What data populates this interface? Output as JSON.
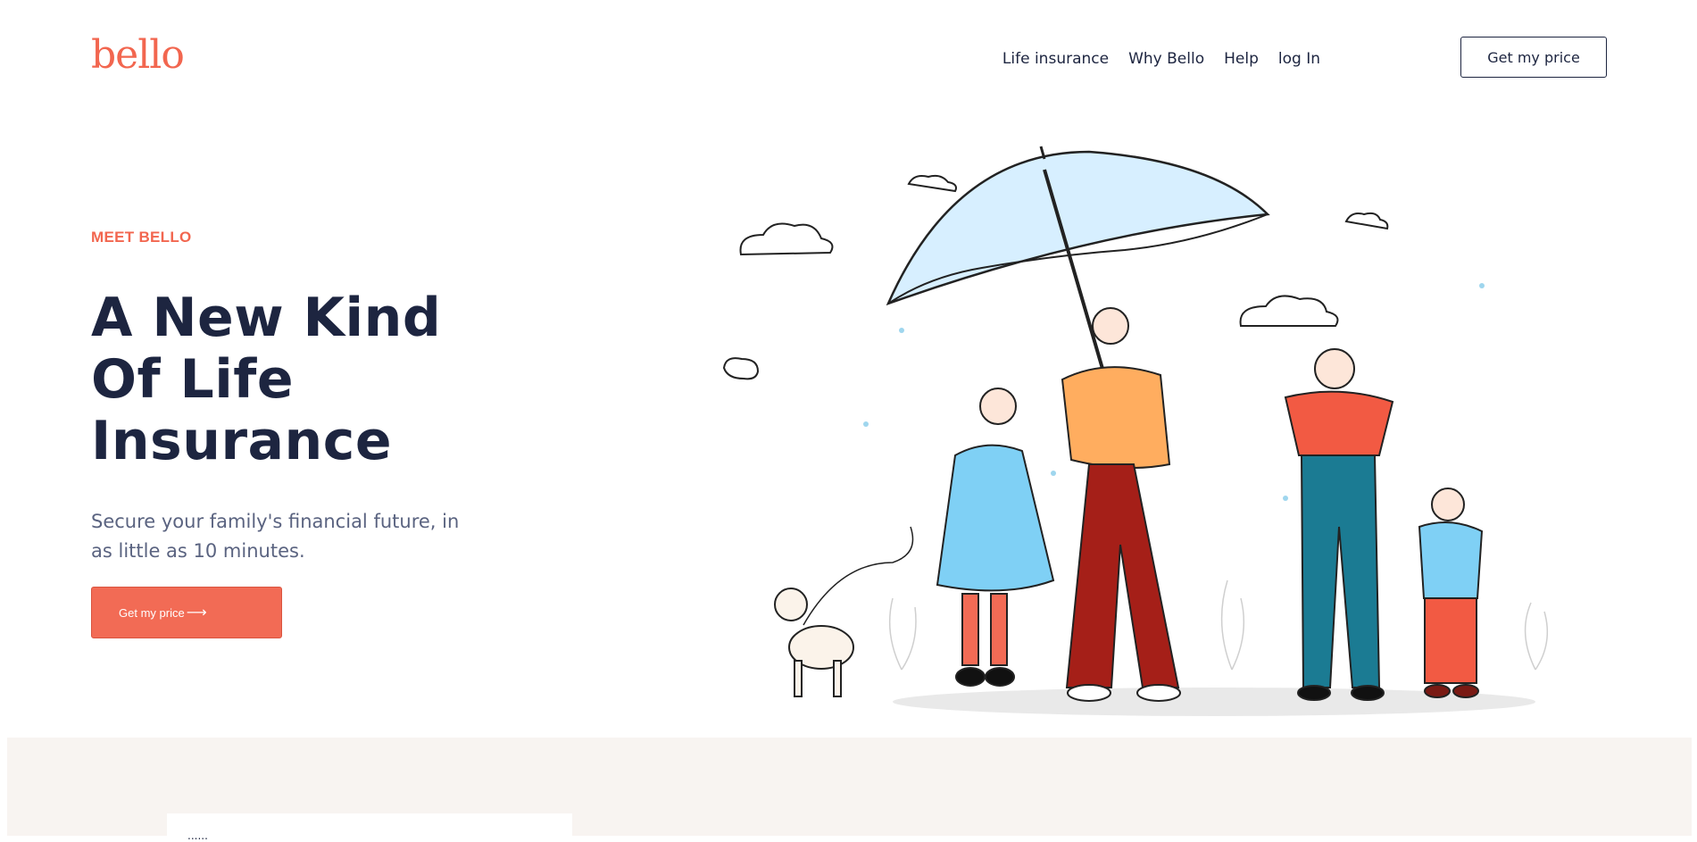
{
  "header": {
    "logo": "bello",
    "nav_items": [
      "Life insurance",
      "Why Bello",
      "Help",
      "log In"
    ],
    "cta_label": "Get my price"
  },
  "hero": {
    "eyebrow": "MEET BELLO",
    "headline_lines": [
      "A New Kind",
      "Of Life",
      "Insurance"
    ],
    "subtext": "Secure your family's financial future, in as little as 10 minutes.",
    "cta_label": "Get my price",
    "cta_icon": "arrow-right-icon"
  },
  "section": {
    "card_text": "......"
  },
  "colors": {
    "brand": "#f2664f",
    "text_dark": "#1d2540",
    "text_muted": "#5a6380",
    "section_bg": "#f8f4f1"
  }
}
